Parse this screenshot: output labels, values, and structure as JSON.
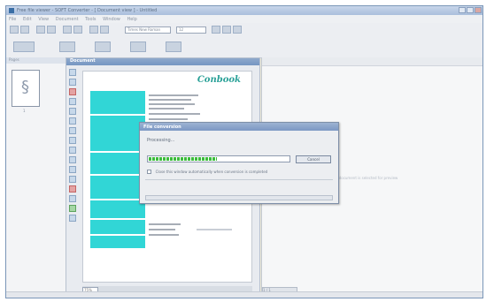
{
  "window": {
    "title": "Free file viewer - SOFT Converter - [ Document view ] - Untitled",
    "menu": [
      "File",
      "Edit",
      "View",
      "Document",
      "Tools",
      "Window",
      "Help"
    ]
  },
  "toolbar": {
    "font_combo": "Times New Roman",
    "size_combo": "12"
  },
  "left_panel": {
    "header": "Pages",
    "thumb_label": "1"
  },
  "doc_panel": {
    "title": "Document",
    "logo": "Conbook",
    "zoom": "75%"
  },
  "right_panel": {
    "empty_message": "No document is selected for preview",
    "scroll_label": "1 / 1"
  },
  "dialog": {
    "title": "File conversion",
    "status": "Processing...",
    "progress": 0.49,
    "cancel_label": "Cancel",
    "checkbox_label": "Close this window automatically when conversion is completed",
    "checkbox_checked": false
  }
}
